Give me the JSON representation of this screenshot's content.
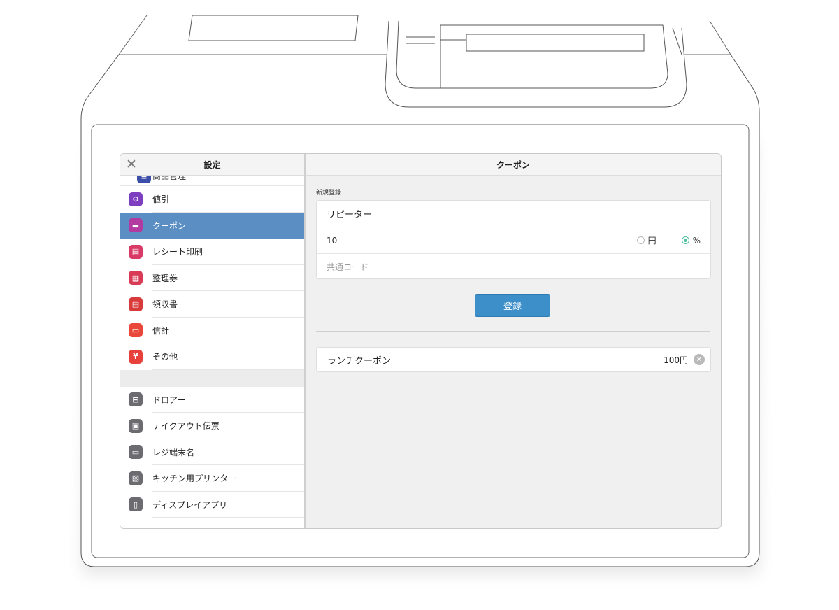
{
  "sidebar": {
    "title": "設定",
    "partial_item": {
      "label": "商品管理",
      "color": "#3b4fa8"
    },
    "items": [
      {
        "label": "値引",
        "icon": "minus-circle-icon",
        "color": "#7d3fbf",
        "glyph": "⊖"
      },
      {
        "label": "クーポン",
        "icon": "coupon-icon",
        "color": "#b23aa0",
        "glyph": "▬",
        "active": true
      },
      {
        "label": "レシート印刷",
        "icon": "receipt-print-icon",
        "color": "#d93a68",
        "glyph": "▤"
      },
      {
        "label": "整理券",
        "icon": "ticket-icon",
        "color": "#d93a55",
        "glyph": "▦"
      },
      {
        "label": "領収書",
        "icon": "receipt-icon",
        "color": "#d93a3a",
        "glyph": "▤"
      },
      {
        "label": "信計",
        "icon": "register-icon",
        "color": "#e8473a",
        "glyph": "▭"
      },
      {
        "label": "その他",
        "icon": "yen-icon",
        "color": "#e8403a",
        "glyph": "¥"
      }
    ],
    "device_items": [
      {
        "label": "ドロアー",
        "icon": "drawer-icon",
        "color": "#6c6c70",
        "glyph": "⊟"
      },
      {
        "label": "テイクアウト伝票",
        "icon": "printer-icon",
        "color": "#6c6c70",
        "glyph": "▣"
      },
      {
        "label": "レジ端末名",
        "icon": "terminal-icon",
        "color": "#6c6c70",
        "glyph": "▭"
      },
      {
        "label": "キッチン用プリンター",
        "icon": "kitchen-printer-icon",
        "color": "#6c6c70",
        "glyph": "▧"
      },
      {
        "label": "ディスプレイアプリ",
        "icon": "display-app-icon",
        "color": "#6c6c70",
        "glyph": "▯"
      }
    ]
  },
  "main": {
    "title": "クーポン",
    "section_label": "新規登録",
    "form": {
      "name_value": "リピーター",
      "amount_value": "10",
      "unit_yen": "円",
      "unit_percent": "%",
      "selected_unit": "%",
      "code_placeholder": "共通コード"
    },
    "register_label": "登録",
    "coupons": [
      {
        "name": "ランチクーポン",
        "amount": "100円"
      }
    ]
  },
  "colors": {
    "accent": "#5b8ec2",
    "button": "#3d8fca",
    "radio_on": "#4fbf9f"
  }
}
